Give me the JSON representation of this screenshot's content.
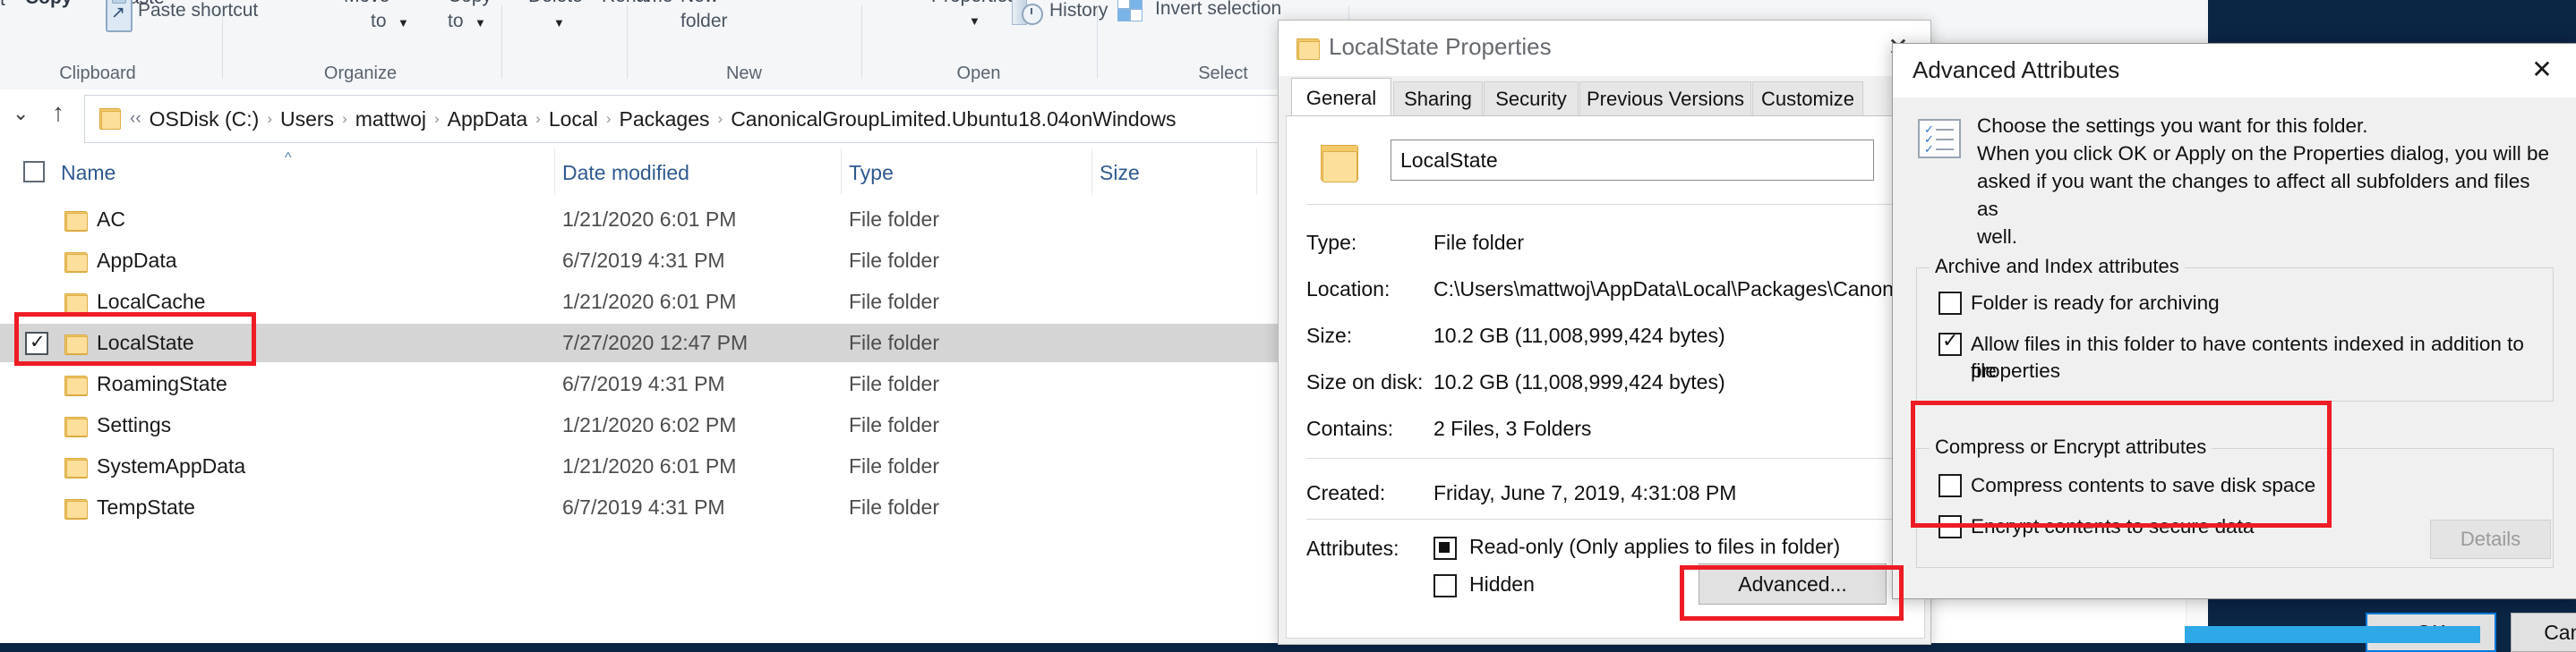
{
  "ribbon": {
    "groups": [
      {
        "label": "Clipboard"
      },
      {
        "label": "Organize"
      },
      {
        "label": "New"
      },
      {
        "label": "Open"
      },
      {
        "label": "Select"
      }
    ],
    "buttons": {
      "cut": "t",
      "copy": "Copy",
      "paste": "Paste",
      "paste_shortcut": "Paste shortcut",
      "move_to_l1": "Move",
      "move_to_l2": "to",
      "copy_to_l1": "Copy",
      "copy_to_l2": "to",
      "delete": "Delete",
      "rename": "Rename",
      "new_folder_l1": "New",
      "new_folder_l2": "folder",
      "properties": "Properties",
      "history": "History",
      "invert_selection": "Invert selection",
      "new_item_cut": "N",
      "new_item_cut2": "fol"
    }
  },
  "address": {
    "chevron": "‹‹",
    "crumbs": [
      "OSDisk (C:)",
      "Users",
      "mattwoj",
      "AppData",
      "Local",
      "Packages",
      "CanonicalGroupLimited.Ubuntu18.04onWindows"
    ],
    "separator": "›"
  },
  "columns": [
    {
      "label": "Name"
    },
    {
      "label": "Date modified"
    },
    {
      "label": "Type"
    },
    {
      "label": "Size"
    }
  ],
  "files": [
    {
      "name": "AC",
      "date": "1/21/2020 6:01 PM",
      "type": "File folder",
      "size": "",
      "selected": false,
      "checked": false
    },
    {
      "name": "AppData",
      "date": "6/7/2019 4:31 PM",
      "type": "File folder",
      "size": "",
      "selected": false,
      "checked": false
    },
    {
      "name": "LocalCache",
      "date": "1/21/2020 6:01 PM",
      "type": "File folder",
      "size": "",
      "selected": false,
      "checked": false
    },
    {
      "name": "LocalState",
      "date": "7/27/2020 12:47 PM",
      "type": "File folder",
      "size": "",
      "selected": true,
      "checked": true
    },
    {
      "name": "RoamingState",
      "date": "6/7/2019 4:31 PM",
      "type": "File folder",
      "size": "",
      "selected": false,
      "checked": false
    },
    {
      "name": "Settings",
      "date": "1/21/2020 6:02 PM",
      "type": "File folder",
      "size": "",
      "selected": false,
      "checked": false
    },
    {
      "name": "SystemAppData",
      "date": "1/21/2020 6:01 PM",
      "type": "File folder",
      "size": "",
      "selected": false,
      "checked": false
    },
    {
      "name": "TempState",
      "date": "6/7/2019 4:31 PM",
      "type": "File folder",
      "size": "",
      "selected": false,
      "checked": false
    }
  ],
  "properties_dialog": {
    "title": "LocalState Properties",
    "close_label": "✕",
    "tabs": [
      {
        "label": "General",
        "active": true
      },
      {
        "label": "Sharing",
        "active": false
      },
      {
        "label": "Security",
        "active": false
      },
      {
        "label": "Previous Versions",
        "active": false
      },
      {
        "label": "Customize",
        "active": false
      }
    ],
    "name_value": "LocalState",
    "rows": [
      {
        "label": "Type:",
        "value": "File folder"
      },
      {
        "label": "Location:",
        "value": "C:\\Users\\mattwoj\\AppData\\Local\\Packages\\Canonic"
      },
      {
        "label": "Size:",
        "value": "10.2 GB (11,008,999,424 bytes)"
      },
      {
        "label": "Size on disk:",
        "value": "10.2 GB (11,008,999,424 bytes)"
      },
      {
        "label": "Contains:",
        "value": "2 Files, 3 Folders"
      },
      {
        "label": "Created:",
        "value": "Friday, June 7, 2019, 4:31:08 PM"
      }
    ],
    "attributes_label": "Attributes:",
    "readonly_label": "Read-only (Only applies to files in folder)",
    "hidden_label": "Hidden",
    "advanced_button": "Advanced..."
  },
  "advanced_dialog": {
    "title": "Advanced Attributes",
    "close_label": "✕",
    "description_line1": "Choose the settings you want for this folder.",
    "description_line2": "When you click OK or Apply on the Properties dialog, you will be",
    "description_line3": "asked if you want the changes to affect all subfolders and files as",
    "description_line4": "well.",
    "archive_group_title": "Archive and Index attributes",
    "archive_checkbox": "Folder is ready for archiving",
    "index_checkbox_line1": "Allow files in this folder to have contents indexed in addition to file",
    "index_checkbox_line2": "properties",
    "compress_group_title": "Compress or Encrypt attributes",
    "compress_checkbox": "Compress contents to save disk space",
    "encrypt_checkbox": "Encrypt contents to secure data",
    "details_button": "Details",
    "ok_button": "OK",
    "cancel_button": "Cancel"
  },
  "colors": {
    "desktop": "#0b2545",
    "annotation": "#ee1c25",
    "selection": "#d5d5d5",
    "accent": "#0078d7",
    "breadcrumb_text": "#2f5a8f"
  }
}
